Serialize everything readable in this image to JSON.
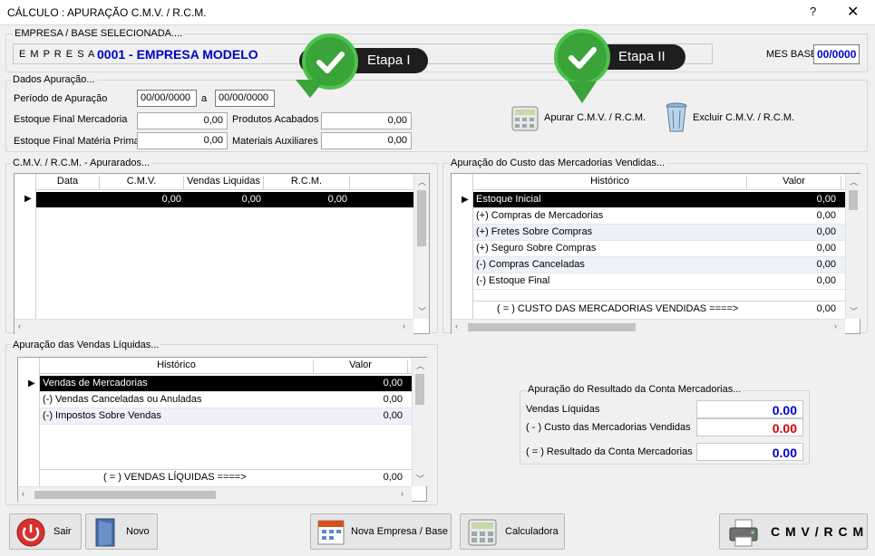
{
  "window": {
    "title": "CÁLCULO : APURAÇÃO C.M.V. / R.C.M.",
    "help": "?",
    "close": "✕"
  },
  "empresa": {
    "group_title": "EMPRESA  /  BASE  SELECIONADA....",
    "label": "E M P R E S A",
    "value": "0001 - EMPRESA MODELO",
    "mes_base_label": "MES BASE",
    "mes_base_value": "00/0000"
  },
  "etapas": {
    "etapa1": "Etapa I",
    "etapa2": "Etapa II"
  },
  "dados": {
    "group_title": "Dados Apuração...",
    "periodo_label": "Período de Apuração",
    "periodo_de": "00/00/0000",
    "periodo_a_label": "a",
    "periodo_ate": "00/00/0000",
    "estoque_mercadoria_label": "Estoque Final Mercadoria",
    "estoque_mercadoria_value": "0,00",
    "produtos_acabados_label": "Produtos Acabados",
    "produtos_acabados_value": "0,00",
    "estoque_materia_label": "Estoque Final Matéria Prima",
    "estoque_materia_value": "0,00",
    "materiais_aux_label": "Materiais Auxiliares",
    "materiais_aux_value": "0,00"
  },
  "actions": {
    "apurar": "Apurar C.M.V. / R.C.M.",
    "excluir": "Excluir C.M.V. / R.C.M."
  },
  "cmv_grid": {
    "title": "C.M.V. / R.C.M. - Apurarados...",
    "headers": [
      "Data",
      "C.M.V.",
      "Vendas Liquidas",
      "R.C.M."
    ],
    "row": [
      "",
      "0,00",
      "0,00",
      "0,00"
    ]
  },
  "custo_grid": {
    "title": "Apuração do Custo das Mercadorias Vendidas...",
    "headers": [
      "Histórico",
      "Valor"
    ],
    "rows": [
      {
        "h": "Estoque Inicial",
        "v": "0,00"
      },
      {
        "h": "(+) Compras de Mercadorias",
        "v": "0,00"
      },
      {
        "h": "(+) Fretes Sobre Compras",
        "v": "0,00"
      },
      {
        "h": "(+) Seguro Sobre Compras",
        "v": "0,00"
      },
      {
        "h": "(-) Compras Canceladas",
        "v": "0,00"
      },
      {
        "h": "(-) Estoque Final",
        "v": "0,00"
      }
    ],
    "footer_label": "( = ) CUSTO DAS MERCADORIAS VENDIDAS  ====>",
    "footer_value": "0,00"
  },
  "vendas_grid": {
    "title": "Apuração das Vendas Líquidas...",
    "headers": [
      "Histórico",
      "Valor"
    ],
    "rows": [
      {
        "h": "Vendas de Mercadorias",
        "v": "0,00"
      },
      {
        "h": "(-) Vendas Canceladas ou Anuladas",
        "v": "0,00"
      },
      {
        "h": "(-) Impostos Sobre Vendas",
        "v": "0,00"
      }
    ],
    "footer_label": "( = ) VENDAS LÍQUIDAS  ====>",
    "footer_value": "0,00"
  },
  "resultado": {
    "title": "Apuração do Resultado da Conta Mercadorias...",
    "vendas_label": "Vendas Líquidas",
    "vendas_value": "0.00",
    "custo_label": "( - ) Custo das Mercadorias Vendidas",
    "custo_value": "0.00",
    "resultado_label": "( = ) Resultado da Conta Mercadorias",
    "resultado_value": "0.00"
  },
  "buttons": {
    "sair": "Sair",
    "novo": "Novo",
    "nova_empresa": "Nova Empresa / Base",
    "calculadora": "Calculadora",
    "cmv": "C M V / R C M"
  },
  "colors": {
    "blue_value": "#0000cc",
    "red_value": "#d00000",
    "green_badge": "#3aa33a"
  }
}
